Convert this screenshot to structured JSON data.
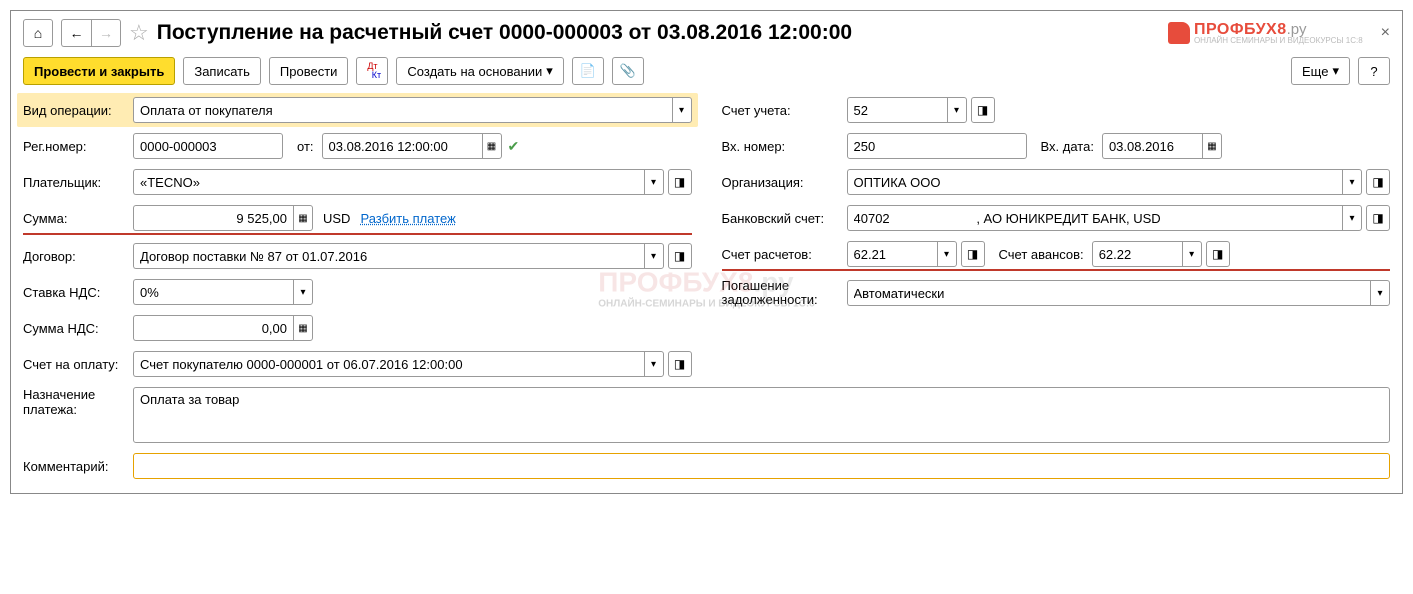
{
  "header": {
    "title": "Поступление на расчетный счет 0000-000003 от 03.08.2016 12:00:00",
    "logo_main": "ПРОФБУХ8",
    "logo_suffix": ".ру",
    "logo_sub": "ОНЛАЙН СЕМИНАРЫ И ВИДЕОКУРСЫ 1С:8"
  },
  "toolbar": {
    "post_close": "Провести и закрыть",
    "write": "Записать",
    "post": "Провести",
    "create_based": "Создать на основании",
    "more": "Еще",
    "help": "?"
  },
  "left": {
    "op_type_label": "Вид операции:",
    "op_type": "Оплата от покупателя",
    "reg_num_label": "Рег.номер:",
    "reg_num": "0000-000003",
    "date_label": "от:",
    "date": "03.08.2016 12:00:00",
    "payer_label": "Плательщик:",
    "payer": "«TECNO»",
    "sum_label": "Сумма:",
    "sum": "9 525,00",
    "currency": "USD",
    "split_link": "Разбить платеж",
    "contract_label": "Договор:",
    "contract": "Договор поставки № 87 от 01.07.2016",
    "vat_rate_label": "Ставка НДС:",
    "vat_rate": "0%",
    "vat_sum_label": "Сумма НДС:",
    "vat_sum": "0,00",
    "invoice_label": "Счет на оплату:",
    "invoice": "Счет покупателю 0000-000001 от 06.07.2016 12:00:00",
    "purpose_label": "Назначение платежа:",
    "purpose": "Оплата за товар",
    "comment_label": "Комментарий:",
    "comment": ""
  },
  "right": {
    "account_label": "Счет учета:",
    "account": "52",
    "in_num_label": "Вх. номер:",
    "in_num": "250",
    "in_date_label": "Вх. дата:",
    "in_date": "03.08.2016",
    "org_label": "Организация:",
    "org": "ОПТИКА ООО",
    "bank_label": "Банковский счет:",
    "bank": "40702                        , АО ЮНИКРЕДИТ БАНК, USD",
    "settle_label": "Счет расчетов:",
    "settle": "62.21",
    "advance_label": "Счет авансов:",
    "advance": "62.22",
    "debt_label": "Погашение задолженности:",
    "debt": "Автоматически"
  }
}
